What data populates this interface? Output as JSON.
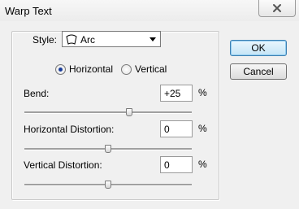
{
  "window": {
    "title": "Warp Text"
  },
  "style": {
    "label": "Style:",
    "value": "Arc",
    "icon": "arc-icon"
  },
  "orientation": {
    "horizontal_label": "Horizontal",
    "vertical_label": "Vertical",
    "selected": "Horizontal"
  },
  "bend": {
    "label": "Bend:",
    "value": "+25",
    "unit": "%",
    "slider_percent": 25
  },
  "horizontal_distortion": {
    "label": "Horizontal Distortion:",
    "value": "0",
    "unit": "%",
    "slider_percent": 0
  },
  "vertical_distortion": {
    "label": "Vertical Distortion:",
    "value": "0",
    "unit": "%",
    "slider_percent": 0
  },
  "buttons": {
    "ok": "OK",
    "cancel": "Cancel"
  }
}
